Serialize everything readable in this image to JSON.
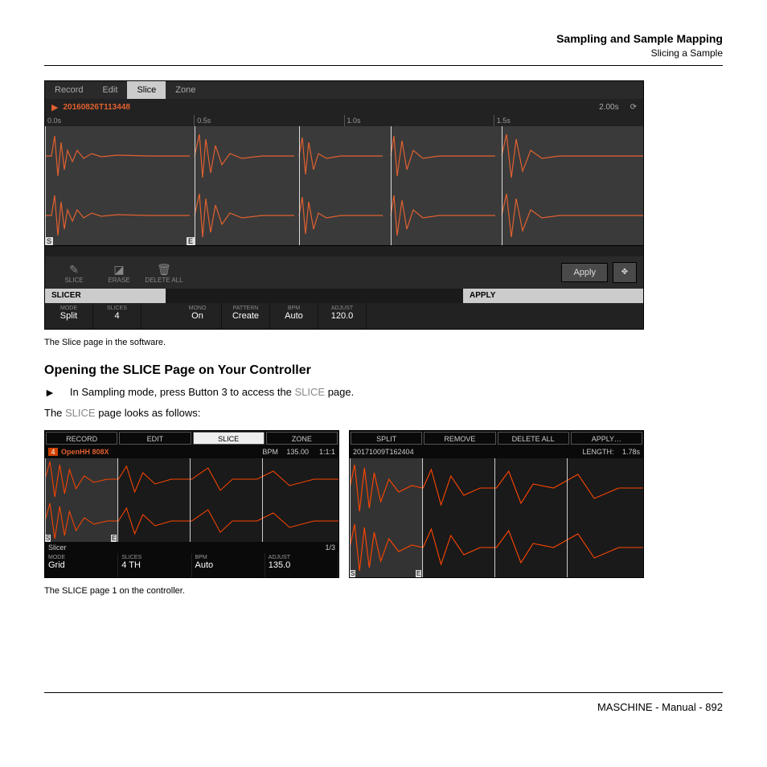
{
  "header": {
    "title": "Sampling and Sample Mapping",
    "subtitle": "Slicing a Sample"
  },
  "sw": {
    "tabs": [
      "Record",
      "Edit",
      "Slice",
      "Zone"
    ],
    "active_tab": "Slice",
    "file_name": "20160826T113448",
    "file_len": "2.00s",
    "loop_icon": "⟳",
    "ruler": [
      "0.0s",
      "0.5s",
      "1.0s",
      "1.5s"
    ],
    "markers": {
      "s": "S",
      "e": "E"
    },
    "tools": {
      "slice": "SLICE",
      "erase": "ERASE",
      "deleteall": "DELETE ALL"
    },
    "apply_btn": "Apply",
    "heads": {
      "slicer": "SLICER",
      "apply": "APPLY"
    },
    "params": {
      "mode": {
        "label": "MODE",
        "value": "Split"
      },
      "slices": {
        "label": "SLICES",
        "value": "4"
      },
      "mono": {
        "label": "MONO",
        "value": "On"
      },
      "pattern": {
        "label": "PATTERN",
        "value": "Create"
      },
      "bpm": {
        "label": "BPM",
        "value": "Auto"
      },
      "adjust": {
        "label": "ADJUST",
        "value": "120.0"
      }
    }
  },
  "caption1": "The Slice page in the software.",
  "section_heading": "Opening the SLICE Page on Your Controller",
  "instruction": {
    "bullet": "►",
    "text_a": "In Sampling mode, press Button 3 to access the ",
    "slice_word": "SLICE",
    "text_b": " page."
  },
  "line2": {
    "a": "The ",
    "slice_word": "SLICE",
    "b": " page looks as follows:"
  },
  "ctrl": {
    "left": {
      "tabs": [
        "RECORD",
        "EDIT",
        "SLICE",
        "ZONE"
      ],
      "active": "SLICE",
      "slot": "4",
      "name": "OpenHH 808X",
      "bpm_label": "BPM",
      "bpm": "135.00",
      "pos": "1:1:1",
      "markers": {
        "s": "S",
        "e": "E"
      },
      "head_l": "Slicer",
      "head_r": "1/3",
      "params": {
        "mode": {
          "label": "MODE",
          "value": "Grid"
        },
        "slices": {
          "label": "SLICES",
          "value": "4 TH"
        },
        "bpm": {
          "label": "BPM",
          "value": "Auto"
        },
        "adjust": {
          "label": "ADJUST",
          "value": "135.0"
        }
      }
    },
    "right": {
      "tabs": [
        "SPLIT",
        "REMOVE",
        "DELETE ALL",
        "APPLY…"
      ],
      "name": "20171009T162404",
      "len_label": "LENGTH:",
      "len": "1.78s",
      "markers": {
        "s": "S",
        "e": "E"
      }
    }
  },
  "caption2": "The SLICE page 1 on the controller.",
  "footer": "MASCHINE - Manual - 892"
}
